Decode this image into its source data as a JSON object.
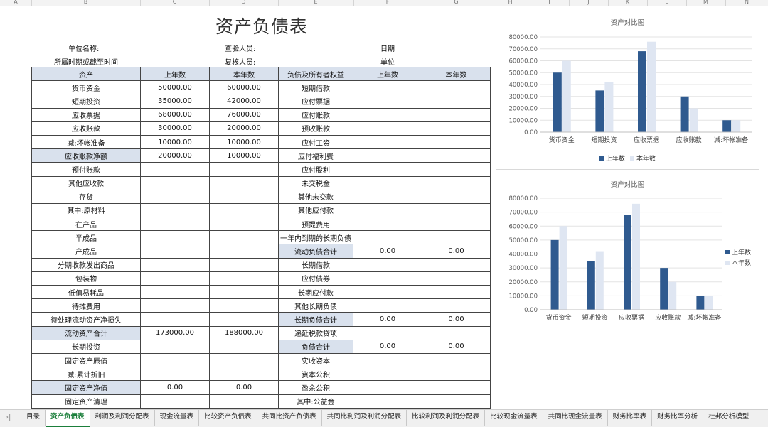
{
  "column_letters": [
    "A",
    "B",
    "C",
    "D",
    "E",
    "F",
    "G",
    "H",
    "I",
    "J",
    "K",
    "L",
    "M",
    "N"
  ],
  "title": "资产负债表",
  "meta": {
    "company": "单位名称:",
    "period": "所属时期或截至时间",
    "checker": "查验人员:",
    "reviewer": "复核人员:",
    "date": "日期",
    "unit": "单位"
  },
  "headers": [
    "资产",
    "上年数",
    "本年数",
    "负债及所有者权益",
    "上年数",
    "本年数"
  ],
  "rows": [
    {
      "a": "货币资金",
      "b": "50000.00",
      "c": "60000.00",
      "d": "短期借款",
      "e": "",
      "f": ""
    },
    {
      "a": "短期投资",
      "b": "35000.00",
      "c": "42000.00",
      "d": "应付票据",
      "e": "",
      "f": ""
    },
    {
      "a": "应收票据",
      "b": "68000.00",
      "c": "76000.00",
      "d": "应付账款",
      "e": "",
      "f": ""
    },
    {
      "a": "应收账款",
      "b": "30000.00",
      "c": "20000.00",
      "d": "预收账款",
      "e": "",
      "f": ""
    },
    {
      "a": "减:坏帐准备",
      "b": "10000.00",
      "c": "10000.00",
      "d": "应付工资",
      "e": "",
      "f": ""
    },
    {
      "a": "应收账款净额",
      "b": "20000.00",
      "c": "10000.00",
      "d": "应付福利费",
      "e": "",
      "f": "",
      "shadeLeft": true
    },
    {
      "a": "预付账款",
      "b": "",
      "c": "",
      "d": "应付股利",
      "e": "",
      "f": ""
    },
    {
      "a": "其他应收款",
      "b": "",
      "c": "",
      "d": "未交税金",
      "e": "",
      "f": ""
    },
    {
      "a": "存货",
      "b": "",
      "c": "",
      "d": "其他未交款",
      "e": "",
      "f": ""
    },
    {
      "a": "其中:原材料",
      "b": "",
      "c": "",
      "d": "其他应付款",
      "e": "",
      "f": ""
    },
    {
      "a": "在产品",
      "b": "",
      "c": "",
      "d": "预提费用",
      "e": "",
      "f": ""
    },
    {
      "a": "半成品",
      "b": "",
      "c": "",
      "d": "一年内到期的长期负债",
      "e": "",
      "f": ""
    },
    {
      "a": "产成品",
      "b": "",
      "c": "",
      "d": "流动负债合计",
      "e": "0.00",
      "f": "0.00",
      "shadeRight": true
    },
    {
      "a": "分期收款发出商品",
      "b": "",
      "c": "",
      "d": "长期借款",
      "e": "",
      "f": ""
    },
    {
      "a": "包装物",
      "b": "",
      "c": "",
      "d": "应付债券",
      "e": "",
      "f": ""
    },
    {
      "a": "低值易耗品",
      "b": "",
      "c": "",
      "d": "长期应付款",
      "e": "",
      "f": ""
    },
    {
      "a": "待摊费用",
      "b": "",
      "c": "",
      "d": "其他长期负债",
      "e": "",
      "f": ""
    },
    {
      "a": "待处理流动资产净损失",
      "b": "",
      "c": "",
      "d": "长期负债合计",
      "e": "0.00",
      "f": "0.00",
      "shadeRight": true
    },
    {
      "a": "流动资产合计",
      "b": "173000.00",
      "c": "188000.00",
      "d": "递延税款贷项",
      "e": "",
      "f": "",
      "shadeLeft": true
    },
    {
      "a": "长期投资",
      "b": "",
      "c": "",
      "d": "负债合计",
      "e": "0.00",
      "f": "0.00",
      "shadeRight": true
    },
    {
      "a": "固定资产原值",
      "b": "",
      "c": "",
      "d": "实收资本",
      "e": "",
      "f": ""
    },
    {
      "a": "减:累计折旧",
      "b": "",
      "c": "",
      "d": "资本公积",
      "e": "",
      "f": ""
    },
    {
      "a": "固定资产净值",
      "b": "0.00",
      "c": "0.00",
      "d": "盈余公积",
      "e": "",
      "f": "",
      "shadeLeft": true
    },
    {
      "a": "固定资产清理",
      "b": "",
      "c": "",
      "d": "其中:公益金",
      "e": "",
      "f": ""
    }
  ],
  "chart_data": [
    {
      "type": "bar",
      "title": "资产对比图",
      "categories": [
        "货币资金",
        "短期投资",
        "应收票据",
        "应收账款",
        "减:坏帐准备"
      ],
      "series": [
        {
          "name": "上年数",
          "values": [
            50000,
            35000,
            68000,
            30000,
            10000
          ],
          "color": "#2f5a8f"
        },
        {
          "name": "本年数",
          "values": [
            60000,
            42000,
            76000,
            20000,
            10000
          ],
          "color": "#dfe6f2"
        }
      ],
      "ylim": [
        0,
        80000
      ],
      "yticks": [
        "0.00",
        "10000.00",
        "20000.00",
        "30000.00",
        "40000.00",
        "50000.00",
        "60000.00",
        "70000.00",
        "80000.00"
      ],
      "grid": true,
      "legend": "bottom"
    },
    {
      "type": "bar",
      "title": "资产对比图",
      "categories": [
        "货币资金",
        "短期投资",
        "应收票据",
        "应收账款",
        "减:坏帐准备"
      ],
      "series": [
        {
          "name": "上年数",
          "values": [
            50000,
            35000,
            68000,
            30000,
            10000
          ],
          "color": "#2f5a8f"
        },
        {
          "name": "本年数",
          "values": [
            60000,
            42000,
            76000,
            20000,
            10000
          ],
          "color": "#dfe6f2"
        }
      ],
      "ylim": [
        0,
        80000
      ],
      "yticks": [
        "0.00",
        "10000.00",
        "20000.00",
        "30000.00",
        "40000.00",
        "50000.00",
        "60000.00",
        "70000.00",
        "80000.00"
      ],
      "grid": true,
      "legend": "right"
    }
  ],
  "tabs": [
    {
      "label": "目录",
      "active": false
    },
    {
      "label": "资产负债表",
      "active": true
    },
    {
      "label": "利润及利润分配表",
      "active": false
    },
    {
      "label": "现金流量表",
      "active": false
    },
    {
      "label": "比较资产负债表",
      "active": false
    },
    {
      "label": "共同比资产负债表",
      "active": false
    },
    {
      "label": "共同比利润及利润分配表",
      "active": false
    },
    {
      "label": "比较利润及利润分配表",
      "active": false
    },
    {
      "label": "比较现金流量表",
      "active": false
    },
    {
      "label": "共同比现金流量表",
      "active": false
    },
    {
      "label": "财务比率表",
      "active": false
    },
    {
      "label": "财务比率分析",
      "active": false
    },
    {
      "label": "杜邦分析模型",
      "active": false
    }
  ],
  "tab_nav_icon": "chevron-right-icon",
  "tab_nav_glyph": "›|"
}
